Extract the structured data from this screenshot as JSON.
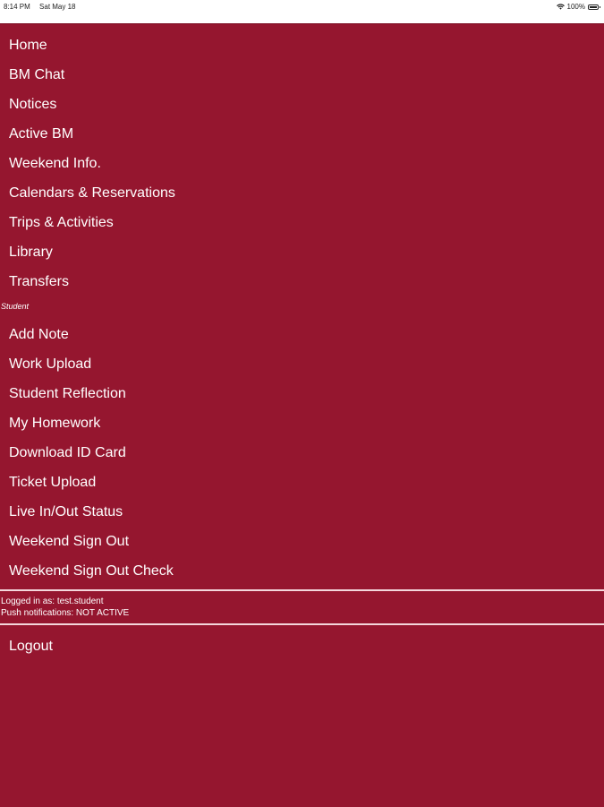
{
  "status_bar": {
    "time": "8:14 PM",
    "date": "Sat May 18",
    "battery_text": "100%",
    "battery_level": 1.0,
    "wifi_icon": "wifi-icon",
    "battery_icon": "battery-icon"
  },
  "theme": {
    "menu_background": "#95162f",
    "text_color": "#ffffff"
  },
  "menu": {
    "main_items": [
      {
        "label": "Home"
      },
      {
        "label": "BM Chat"
      },
      {
        "label": "Notices"
      },
      {
        "label": "Active BM"
      },
      {
        "label": "Weekend Info."
      },
      {
        "label": "Calendars & Reservations"
      },
      {
        "label": "Trips & Activities"
      },
      {
        "label": "Library"
      },
      {
        "label": "Transfers"
      }
    ],
    "student_section_label": "Student",
    "student_items": [
      {
        "label": "Add Note"
      },
      {
        "label": "Work Upload"
      },
      {
        "label": "Student Reflection"
      },
      {
        "label": "My Homework"
      },
      {
        "label": "Download ID Card"
      },
      {
        "label": "Ticket Upload"
      },
      {
        "label": "Live In/Out Status"
      },
      {
        "label": "Weekend Sign Out"
      },
      {
        "label": "Weekend Sign Out Check"
      }
    ],
    "logged_in_text": "Logged in as: test.student",
    "push_text": "Push notifications: NOT ACTIVE",
    "logout_label": "Logout"
  }
}
